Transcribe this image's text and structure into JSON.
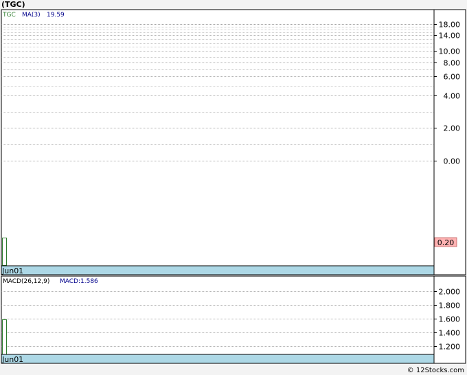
{
  "title": "(TGC)",
  "footer": "© 12Stocks.com",
  "colors": {
    "grid": "#9a9a9a",
    "axis_bar": "#add8e6",
    "price_bar": "#2e7d2e",
    "ma_label": "#00008b",
    "last_box": "#ffb3b3"
  },
  "chart_data": [
    {
      "type": "bar",
      "ticker": "TGC",
      "indicator_label": "MA(3)",
      "indicator_value": "19.59",
      "y_scale": "custom-nonlinear",
      "y_ticks": [
        "18.00",
        "14.00",
        "10.00",
        "8.00",
        "6.00",
        "4.00",
        "2.00",
        "0.00"
      ],
      "last_value_label": "0.20",
      "x_labels": [
        "Jun01"
      ],
      "series": [
        {
          "name": "TGC",
          "values": [
            0.2
          ]
        }
      ],
      "grid": true
    },
    {
      "type": "bar",
      "indicator_label": "MACD(26,12,9)",
      "macd_label": "MACD:1.586",
      "y_ticks": [
        "2.000",
        "1.800",
        "1.600",
        "1.400",
        "1.200"
      ],
      "ylim": [
        1.1,
        2.1
      ],
      "x_labels": [
        "Jun01"
      ],
      "series": [
        {
          "name": "MACD",
          "values": [
            1.586
          ]
        }
      ],
      "grid": true
    }
  ]
}
